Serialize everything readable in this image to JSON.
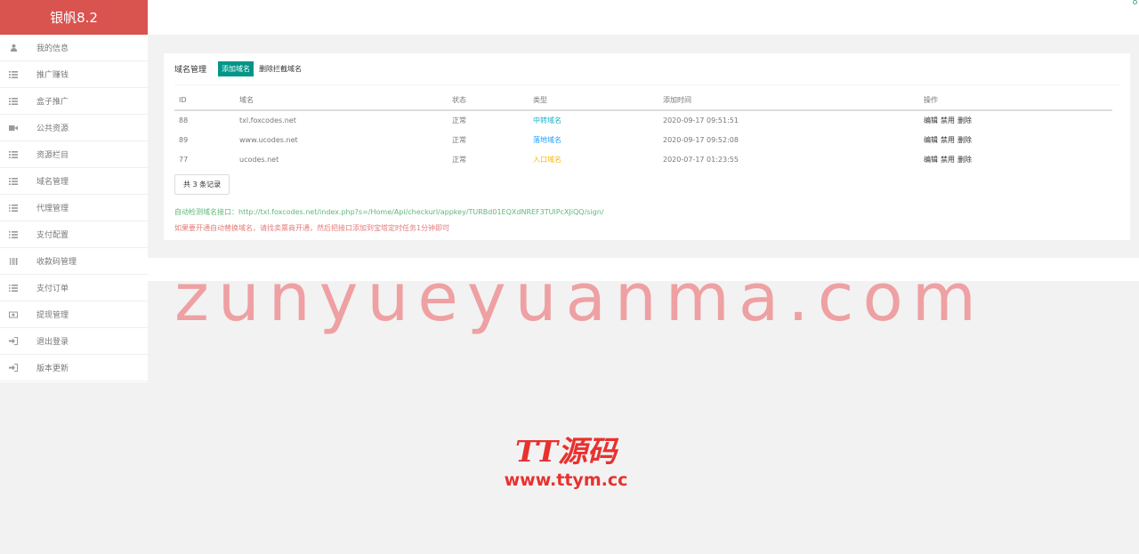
{
  "brand": "银帆8.2",
  "sidebar": {
    "items": [
      {
        "label": "我的信息",
        "icon": "user-icon"
      },
      {
        "label": "推广赚钱",
        "icon": "list-icon"
      },
      {
        "label": "盒子推广",
        "icon": "list-icon"
      },
      {
        "label": "公共资源",
        "icon": "video-icon"
      },
      {
        "label": "资源栏目",
        "icon": "list-icon"
      },
      {
        "label": "域名管理",
        "icon": "list-icon"
      },
      {
        "label": "代理管理",
        "icon": "list-ol-icon"
      },
      {
        "label": "支付配置",
        "icon": "list-ol-icon"
      },
      {
        "label": "收款码管理",
        "icon": "barcode-icon"
      },
      {
        "label": "支付订单",
        "icon": "list-ol-icon"
      },
      {
        "label": "提现管理",
        "icon": "money-icon"
      },
      {
        "label": "退出登录",
        "icon": "sign-in-icon"
      },
      {
        "label": "版本更新",
        "icon": "sign-in-icon"
      }
    ]
  },
  "main": {
    "title": "域名管理",
    "add_button": "添加域名",
    "delete_button": "删除拦截域名",
    "table": {
      "headers": [
        "ID",
        "域名",
        "状态",
        "类型",
        "添加时间",
        "操作"
      ],
      "rows": [
        {
          "id": "88",
          "domain": "txl.foxcodes.net",
          "status": "正常",
          "type": "中转域名",
          "time": "2020-09-17 09:51:51",
          "edit": "编辑",
          "ban": "禁用",
          "del": "删除"
        },
        {
          "id": "89",
          "domain": "www.ucodes.net",
          "status": "正常",
          "type": "落地域名",
          "time": "2020-09-17 09:52:08",
          "edit": "编辑",
          "ban": "禁用",
          "del": "删除"
        },
        {
          "id": "77",
          "domain": "ucodes.net",
          "status": "正常",
          "type": "入口域名",
          "time": "2020-07-17 01:23:55",
          "edit": "编辑",
          "ban": "禁用",
          "del": "删除"
        }
      ]
    },
    "total": "共 3 条记录",
    "note_api": "自动检测域名接口：http://txl.foxcodes.net/index.php?s=/Home/Api/checkurl/appkey/TURBd01EQXdNREF3TUlPcXJiQQ/sign/",
    "note_tip": "如果要开通自动替换域名，请找卖票商开通，然后把接口添加到宝塔定时任务1分钟即可"
  },
  "watermark": {
    "text": "zunyueyuanma.com",
    "logo": "TT源码",
    "url": "www.ttym.cc"
  },
  "colors": {
    "brand": "#d9534f",
    "primary_button": "#009688",
    "type_transfer": "#1bb1c6",
    "type_landing": "#1e9fff",
    "type_entry": "#ffb800",
    "note_api": "#5fb878",
    "note_tip": "#e47a7a"
  }
}
